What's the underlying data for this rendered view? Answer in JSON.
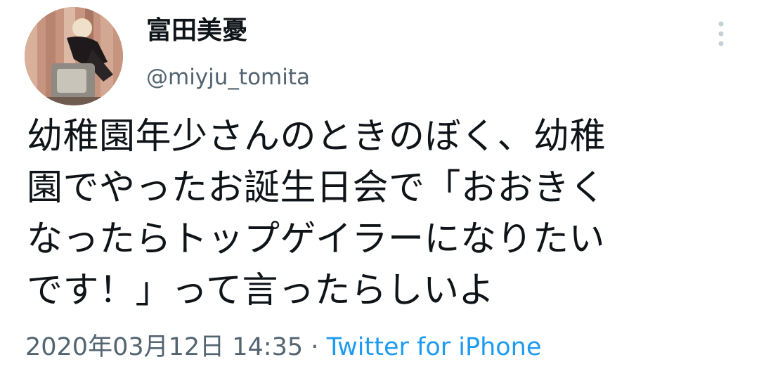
{
  "user": {
    "display_name": "富田美憂",
    "handle": "@miyju_tomita",
    "avatar": "profile-photo"
  },
  "tweet": {
    "text_lines": [
      "幼稚園年少さんのときのぼく、幼稚",
      "園でやったお誕生日会で「おおきく",
      "なったらトップゲイラーになりたい",
      "です！」って言ったらしいよ"
    ],
    "timestamp": "2020年03月12日 14:35",
    "separator": "·",
    "source": "Twitter for iPhone"
  },
  "icons": {
    "more": "more-vertical-icon"
  },
  "colors": {
    "text": "#0f1419",
    "secondary": "#536471",
    "link": "#1d9bf0",
    "icon": "#c4cfd6"
  }
}
